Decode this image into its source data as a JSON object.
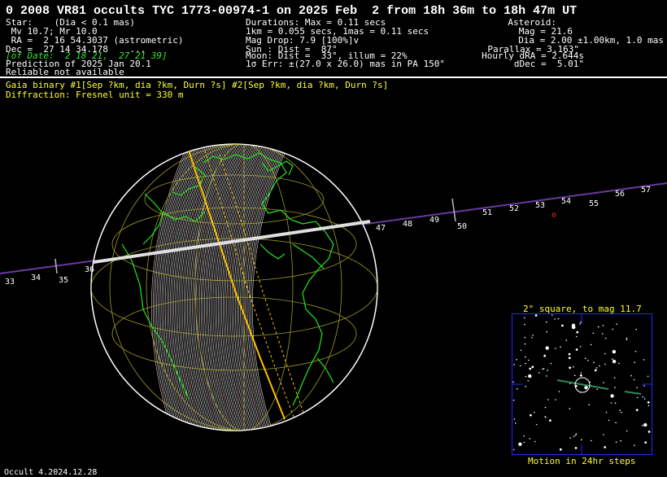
{
  "title": "0 2008 VR81 occults TYC 1773-00974-1 on 2025 Feb  2 from 18h 36m to 18h 47m UT",
  "star": {
    "l1": "Star:    (Dia < 0.1 mas)",
    "l2": " Mv 10.7; Mr 10.0",
    "l3": " RA =  2 16 54.3037 (astrometric)",
    "l4": "Dec =  27 14 34.178    ...",
    "l5": "[of Date:  2 18 21,  27 21 39]",
    "l6": "Prediction of 2025 Jan 20.1",
    "l7": "Reliable not available"
  },
  "event": {
    "l1": "Durations: Max = 0.11 secs",
    "l2": "1km = 0.055 secs, 1mas = 0.11 secs",
    "l3": "Mag Drop: 7.9 [100%]v",
    "l4": "Sun : Dist =  87°",
    "l5": "Moon: Dist =  33°, illum = 22%",
    "l6": "1σ Err: ±(27.0 x 26.0) mas in PA 150°"
  },
  "asteroid": {
    "l1": "Asteroid:",
    "l2": "Mag = 21.6",
    "l3": "Dia = 2.00 ±1.00km, 1.0 mas",
    "l4": "Parallax = 3.163\"",
    "l5": "Hourly dRA = 2.644s",
    "l6": "dDec =  5.01\""
  },
  "notes": {
    "gaia": "Gaia binary #1[Sep ?km, dia ?km, Durn ?s] #2[Sep ?km, dia ?km, Durn ?s]",
    "diffraction": "Diffraction: Fresnel unit = 330 m"
  },
  "path_ticks": [
    "33",
    "34",
    "35",
    "36",
    "47",
    "48",
    "49",
    "50",
    "51",
    "52",
    "53",
    "54",
    "55",
    "56",
    "57"
  ],
  "inset": {
    "title": "2° square, to mag 11.7",
    "caption": "Motion in 24hr steps"
  },
  "footer": "Occult 4.2024.12.28",
  "colors": {
    "background": "#000000",
    "path_center": "#ffffff",
    "path_limit": "#ffc000",
    "coastline": "#22e822",
    "graticule": "#b8b830",
    "track": "#6a3aa0",
    "inset_border": "#1f2cff",
    "label_yellow": "#ffff30"
  }
}
